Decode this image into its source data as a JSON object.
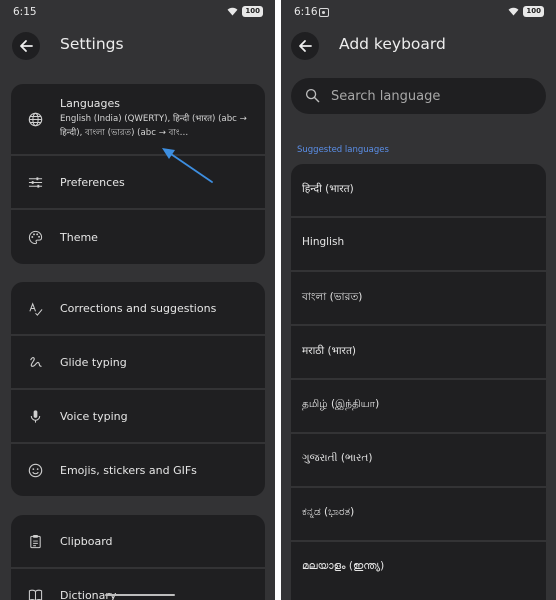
{
  "left": {
    "status": {
      "time": "6:15",
      "battery": "100"
    },
    "appbar": {
      "title": "Settings"
    },
    "groups": [
      [
        {
          "label": "Languages",
          "subtitle": "English (India) (QWERTY), हिन्दी (भारत) (abc → हिन्दी), বাংলা (ভারত) (abc → বাং…",
          "icon": "globe-icon"
        },
        {
          "label": "Preferences",
          "icon": "sliders-icon"
        },
        {
          "label": "Theme",
          "icon": "palette-icon"
        }
      ],
      [
        {
          "label": "Corrections and suggestions",
          "icon": "spellcheck-icon"
        },
        {
          "label": "Glide typing",
          "icon": "gesture-icon"
        },
        {
          "label": "Voice typing",
          "icon": "mic-icon"
        },
        {
          "label": "Emojis, stickers and GIFs",
          "icon": "emoji-icon"
        }
      ],
      [
        {
          "label": "Clipboard",
          "icon": "clipboard-icon"
        },
        {
          "label": "Dictionary",
          "icon": "book-icon"
        }
      ]
    ],
    "arrow_color": "#3d8ee0"
  },
  "right": {
    "status": {
      "time": "6:16",
      "battery": "100"
    },
    "appbar": {
      "title": "Add keyboard"
    },
    "search": {
      "placeholder": "Search language"
    },
    "section_title": "Suggested languages",
    "languages": [
      "हिन्दी (भारत)",
      "Hinglish",
      "বাংলা (ভারত)",
      "मराठी (भारत)",
      "தமிழ் (இந்தியா)",
      "ગુજરાતી (ભારત)",
      "ಕನ್ನಡ (ಭಾರತ)",
      "മലയാളം (ഇന്ത്യ)"
    ]
  },
  "colors": {
    "background": "#333335",
    "card": "#1f1f21",
    "accent": "#5b8fe8"
  }
}
